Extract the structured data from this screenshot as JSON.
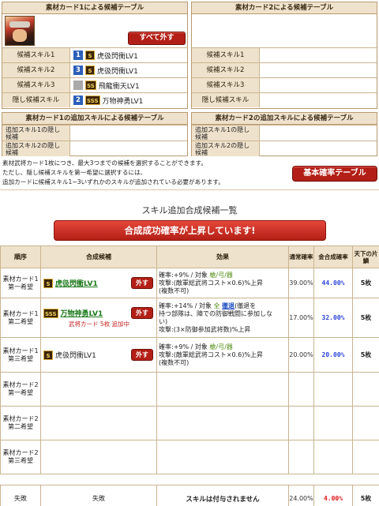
{
  "card1": {
    "header": "素材カード1による候補テーブル",
    "remove_all": "すべて外す",
    "rows": [
      {
        "label": "候補スキル1",
        "num": "1",
        "rank": "S",
        "skill": "虎彶閃衝LV1"
      },
      {
        "label": "候補スキル2",
        "num": "3",
        "rank": "S",
        "skill": "虎彶閃衝LV1"
      },
      {
        "label": "候補スキル3",
        "num": "",
        "rank": "SS",
        "skill": "飛龍衝天LV1"
      },
      {
        "label": "隠し候補スキル",
        "num": "2",
        "rank": "SSS",
        "skill": "万物神勇LV1"
      }
    ]
  },
  "card2": {
    "header": "素材カード2による候補テーブル",
    "rows": [
      {
        "label": "候補スキル1"
      },
      {
        "label": "候補スキル2"
      },
      {
        "label": "候補スキル3"
      },
      {
        "label": "隠し候補スキル"
      }
    ]
  },
  "add1": {
    "header": "素材カード1の追加スキルによる候補テーブル",
    "r1": "追加スキル1の隠し候補",
    "r2": "追加スキル2の隠し候補"
  },
  "add2": {
    "header": "素材カード2の追加スキルによる候補テーブル",
    "r1": "追加スキル1の隠し候補",
    "r2": "追加スキル2の隠し候補"
  },
  "notes": {
    "line1": "素材武将カード1枚につき、最大3つまでの候補を選択することができます。",
    "line2": "ただし、隠し候補スキルを第一希望に選択するには、",
    "line3": "追加カードに候補スキル1~3いずれかのスキルが追加されている必要があります。"
  },
  "base_rate_button": "基本確率テーブル",
  "list_title": "スキル追加合成候補一覧",
  "banner": "合成成功確率が上昇しています!",
  "table": {
    "headers": [
      "順序",
      "合成候補",
      "効果",
      "通常確率",
      "金合成確率",
      "天下の片鱗"
    ],
    "remove_label": "外す",
    "rows": [
      {
        "order1": "素材カード1",
        "order2": "第一希望",
        "rank": "S",
        "skill": "虎彶閃衝LV1",
        "link": true,
        "eff1": "確率:+9% / 対象 ",
        "eff1b": "槍/弓/器",
        "eff2": "攻撃:(敵軍総武将コスト×0.6)%上昇",
        "eff3": "(複数不可)",
        "eff4": "",
        "rate": "39.00%",
        "gold": "44.00%",
        "count": "5枚",
        "note": ""
      },
      {
        "order1": "素材カード1",
        "order2": "第二希望",
        "rank": "SSS",
        "skill": "万物神勇LV1",
        "link": true,
        "eff1": "確率:+14% / 対象 ",
        "eff1b": "全",
        "eff1c": "徹退",
        "eff1d": "(徹退を",
        "eff2": "持つ部隊は、陣での防御戦闘に参加しな",
        "eff3": "い)",
        "eff4": "攻撃:(3×防御参加武将数)%上昇",
        "rate": "17.00%",
        "gold": "32.00%",
        "count": "5枚",
        "note": "武将カード 5枚 追加中"
      },
      {
        "order1": "素材カード1",
        "order2": "第三希望",
        "rank": "S",
        "skill": "虎彶閃衝LV1",
        "link": false,
        "eff1": "確率:+9% / 対象 ",
        "eff1b": "槍/弓/器",
        "eff2": "攻撃:(敵軍総武将コスト×0.6)%上昇",
        "eff3": "(複数不可)",
        "eff4": "",
        "rate": "20.00%",
        "gold": "20.00%",
        "count": "5枚",
        "note": ""
      },
      {
        "order1": "素材カード2",
        "order2": "第一希望"
      },
      {
        "order1": "素材カード2",
        "order2": "第二希望"
      },
      {
        "order1": "素材カード2",
        "order2": "第三希望"
      }
    ],
    "fail": {
      "order": "失敗",
      "candidate": "失敗",
      "effect": "スキルは付与されません",
      "rate": "24.00%",
      "gold": "4.00%",
      "count": "5枚"
    }
  },
  "colors": {
    "accent_red": "#b31f16",
    "panel_bg": "#efe2cc",
    "rate_blue": "#2b43d6",
    "rate_red": "#e01515"
  }
}
